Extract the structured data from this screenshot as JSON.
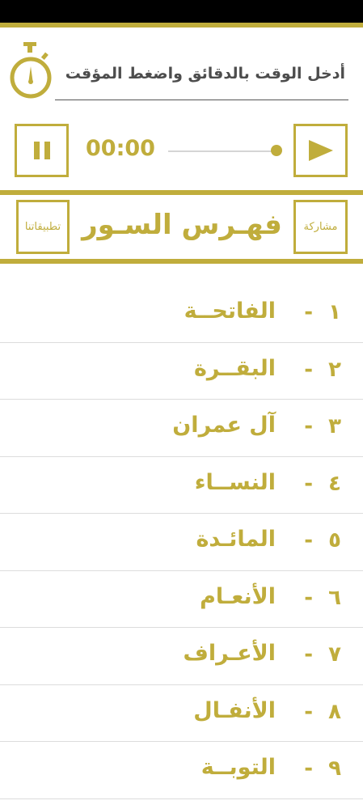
{
  "timer": {
    "label": "أدخل الوقت بالدقائق واضغط المؤقت",
    "time": "00:00",
    "progress": 1.0
  },
  "header": {
    "title": "فهـرس السـور",
    "share_label": "مشاركة",
    "apps_label": "تطبيقاتنا"
  },
  "colors": {
    "accent": "#c0ad3c",
    "text_dark": "#4d4d4d",
    "divider": "#dcdcdc"
  },
  "surahs": [
    {
      "number": "١",
      "name": "الفاتحــة"
    },
    {
      "number": "٢",
      "name": "البقــرة"
    },
    {
      "number": "٣",
      "name": "آل عمران"
    },
    {
      "number": "٤",
      "name": "النســاء"
    },
    {
      "number": "٥",
      "name": "المائـدة"
    },
    {
      "number": "٦",
      "name": "الأنعـام"
    },
    {
      "number": "٧",
      "name": "الأعـراف"
    },
    {
      "number": "٨",
      "name": "الأنفـال"
    },
    {
      "number": "٩",
      "name": "التوبــة"
    }
  ],
  "separator": "-"
}
